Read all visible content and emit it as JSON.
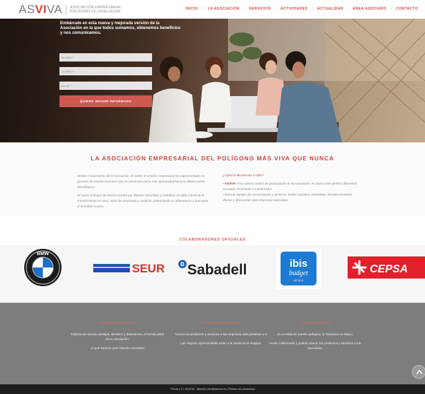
{
  "header": {
    "logo_prefix": "AS",
    "logo_accent": "VI",
    "logo_suffix": "VA",
    "logo_line1": "ASOCIACIÓN EMPRESARIAL",
    "logo_line2": "POLÍGONO VILLAVALLECAS",
    "nav": [
      "INICIO",
      "LA ASOCIACIÓN",
      "SERVICIOS",
      "ACTIVIDADES",
      "ACTUALIDAD",
      "ÁREA ASOCIADO",
      "CONTACTO"
    ]
  },
  "hero": {
    "headline": "Embárcate en esta nueva y mejorada versión de la Asociación en la que todos sumamos, obtenemos beneficios y nos comunicamos.",
    "form": {
      "name_placeholder": "Nombre *",
      "surname_placeholder": "Apellido *",
      "email_placeholder": "Email *",
      "submit_label": "QUIERO SEGUIR INFORMADO"
    }
  },
  "about": {
    "title": "LA ASOCIACIÓN EMPRESARIAL DEL POLÍGONO MÁS VIVA QUE NUNCA",
    "left_p1": "Desde el nacimiento de la Asociación, en 1983, el entorno empresarial ha experimentado un proceso de transformaciones que se presentan como una oportunidad hacia la dinamización del polígono.",
    "left_p2": "El nuevo enfoque de ASVIVA tendrá por objetivo consolidar y revitalizar el tejido industrial al transformarse en nexo, entre las empresas y usuarios, potenciando su información y buscando el beneficio común.",
    "right_q": "¿Cómo lo llevaremos a cabo?",
    "right_b1_brand": "ASVIVA",
    "right_b1_rest": " crea nuevos modos de participación en la Asociación, en base a tres perfiles diferentes: Asociado, Proveedor y Colaborador.",
    "right_b2": "Nuevos canales de comunicación y servicios: Redes Sociales, Newsletter, Revista trimestral, ofertas y descuentos para empresas asociadas."
  },
  "collaborators": {
    "title": "COLABORADORES OFICIALES",
    "logos": [
      {
        "name": "BMW",
        "text": "BMW"
      },
      {
        "name": "SEUR",
        "text": "SEUR"
      },
      {
        "name": "Sabadell",
        "text": "Sabadell"
      },
      {
        "name": "ibis budget",
        "text1": "ibis",
        "text2": "budget",
        "text3": "HOTELS"
      },
      {
        "name": "CEPSA",
        "text": "CEPSA"
      }
    ]
  },
  "footer": {
    "col1_title": "HAZTE ASOCIADO",
    "col1_p1": "Disfruta de nuevas ventajas, servicios y descuentos, al formar parte de tu Asociación.",
    "col1_p2": "¡A qué esperas para hacerte Asociado!",
    "col2_title": "ZONA PROVEEDOR",
    "col2_p1": "Acerca tus productos y servicios a las empresas más próximas a ti.",
    "col2_p2": "Las mejores oportunidades están a la vuelta de la esquina.",
    "col3_title": "COLABORADOR",
    "col3_p1": "Si no estás en nuestro polígono, te hacemos un hueco.",
    "col3_p2": "Hazte colaborador y podrás ofrecer tus productos y servicios a los asociados.",
    "copyright": "©Todo | © | ASVIVA - Madrid | info@asviva.es | Política de privacidad"
  },
  "colors": {
    "accent": "#c9443e",
    "footer_bg": "#7d7d7d",
    "bottom_bar": "#1e1e1e"
  }
}
